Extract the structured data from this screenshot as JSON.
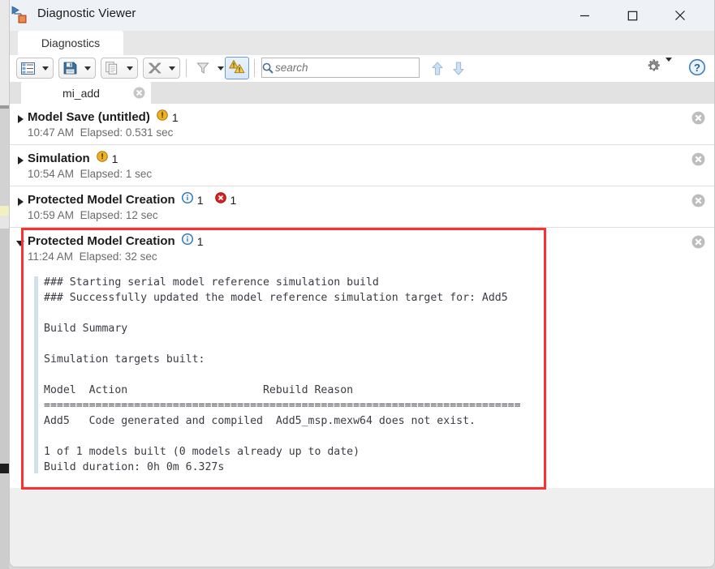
{
  "window": {
    "title": "Diagnostic Viewer",
    "app_icon": "simulink-model-icon",
    "minimize_label": "Minimize",
    "maximize_label": "Maximize",
    "close_label": "Close"
  },
  "ribbon": {
    "tabs": [
      {
        "label": "Diagnostics",
        "icon": "diagnostics-tab"
      }
    ]
  },
  "toolbar": {
    "buttons": [
      {
        "name": "view-options-button",
        "icon": "list-view-icon",
        "has_dropdown": true
      },
      {
        "name": "save-button",
        "icon": "floppy-save-icon",
        "has_dropdown": true
      },
      {
        "name": "copy-button",
        "icon": "copy-pages-icon",
        "has_dropdown": true
      },
      {
        "name": "clear-button",
        "icon": "clear-x-icon",
        "has_dropdown": true
      },
      {
        "name": "filter-button",
        "icon": "funnel-filter-icon",
        "has_dropdown": true
      },
      {
        "name": "warnings-toggle-button",
        "icon": "stacked-warning-triangles-icon",
        "active": true
      }
    ],
    "search": {
      "placeholder": "search",
      "value": "",
      "icon": "search-icon"
    },
    "nav_up": {
      "name": "previous-match-button",
      "icon": "arrow-up-icon"
    },
    "nav_down": {
      "name": "next-match-button",
      "icon": "arrow-down-icon"
    },
    "settings": {
      "name": "settings-button",
      "icon": "gear-icon",
      "has_dropdown": true
    },
    "help": {
      "name": "help-button",
      "icon": "question-mark-icon"
    }
  },
  "document_tabs": [
    {
      "label": "mi_add",
      "close_icon": "close-circle-icon",
      "active": true
    }
  ],
  "messages": [
    {
      "title": "Model Save (untitled)",
      "expanded": false,
      "badges": [
        {
          "type": "warning",
          "icon": "warning-icon",
          "count": "1"
        }
      ],
      "time": "10:47 AM",
      "elapsed": "Elapsed: 0.531 sec",
      "close_icon": "close-circle-icon"
    },
    {
      "title": "Simulation",
      "expanded": false,
      "badges": [
        {
          "type": "warning",
          "icon": "warning-icon",
          "count": "1"
        }
      ],
      "time": "10:54 AM",
      "elapsed": "Elapsed: 1 sec",
      "close_icon": "close-circle-icon"
    },
    {
      "title": "Protected Model Creation",
      "expanded": false,
      "badges": [
        {
          "type": "info",
          "icon": "info-icon",
          "count": "1"
        },
        {
          "type": "error",
          "icon": "error-icon",
          "count": "1"
        }
      ],
      "time": "10:59 AM",
      "elapsed": "Elapsed: 12 sec",
      "close_icon": "close-circle-icon"
    },
    {
      "title": "Protected Model Creation",
      "expanded": true,
      "badges": [
        {
          "type": "info",
          "icon": "info-icon",
          "count": "1"
        }
      ],
      "time": "11:24 AM",
      "elapsed": "Elapsed: 32 sec",
      "close_icon": "close-circle-icon",
      "log": "### Starting serial model reference simulation build\n### Successfully updated the model reference simulation target for: Add5\n\nBuild Summary\n\nSimulation targets built:\n\nModel  Action                     Rebuild Reason\n==========================================================================\nAdd5   Code generated and compiled  Add5_msp.mexw64 does not exist.\n\n1 of 1 models built (0 models already up to date)\nBuild duration: 0h 0m 6.327s"
    }
  ],
  "highlight": {
    "name": "red-annotation-box",
    "color": "#fc3030"
  },
  "colors": {
    "warning": "#e8b426",
    "info": "#2a72b5",
    "error": "#dd2222",
    "title_text": "#1c1c1c",
    "sub_text": "#6b6b6b",
    "log_text": "#3b3b44",
    "gutter": "#cfe2ec",
    "toolbar_active_border": "#6a9fd4"
  }
}
